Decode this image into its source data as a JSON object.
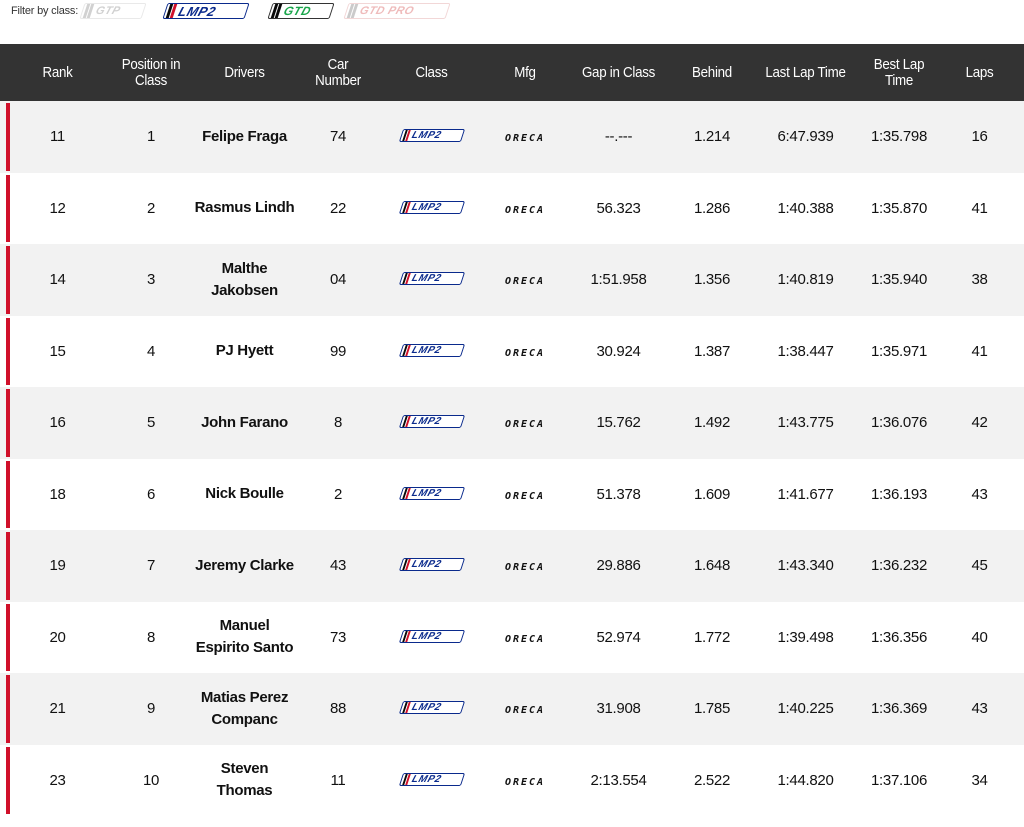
{
  "filter": {
    "label": "Filter by class:",
    "classes": [
      {
        "label": "GTP",
        "active": false
      },
      {
        "label": "LMP2",
        "active": true
      },
      {
        "label": "GTD",
        "active": true
      },
      {
        "label": "GTD PRO",
        "active": false
      }
    ]
  },
  "table": {
    "headers": [
      "Rank",
      "Position in Class",
      "Drivers",
      "Car Number",
      "Class",
      "Mfg",
      "Gap in Class",
      "Behind",
      "Last Lap Time",
      "Best Lap Time",
      "Laps"
    ],
    "rows": [
      {
        "rank": "11",
        "pos": "1",
        "driver1": "Felipe Fraga",
        "driver2": "",
        "car": "74",
        "class": "LMP2",
        "mfg": "ORECA",
        "gap": "--.---",
        "behind": "1.214",
        "last": "6:47.939",
        "best": "1:35.798",
        "laps": "16"
      },
      {
        "rank": "12",
        "pos": "2",
        "driver1": "Rasmus Lindh",
        "driver2": "",
        "car": "22",
        "class": "LMP2",
        "mfg": "ORECA",
        "gap": "56.323",
        "behind": "1.286",
        "last": "1:40.388",
        "best": "1:35.870",
        "laps": "41"
      },
      {
        "rank": "14",
        "pos": "3",
        "driver1": "Malthe",
        "driver2": "Jakobsen",
        "car": "04",
        "class": "LMP2",
        "mfg": "ORECA",
        "gap": "1:51.958",
        "behind": "1.356",
        "last": "1:40.819",
        "best": "1:35.940",
        "laps": "38"
      },
      {
        "rank": "15",
        "pos": "4",
        "driver1": "PJ Hyett",
        "driver2": "",
        "car": "99",
        "class": "LMP2",
        "mfg": "ORECA",
        "gap": "30.924",
        "behind": "1.387",
        "last": "1:38.447",
        "best": "1:35.971",
        "laps": "41"
      },
      {
        "rank": "16",
        "pos": "5",
        "driver1": "John Farano",
        "driver2": "",
        "car": "8",
        "class": "LMP2",
        "mfg": "ORECA",
        "gap": "15.762",
        "behind": "1.492",
        "last": "1:43.775",
        "best": "1:36.076",
        "laps": "42"
      },
      {
        "rank": "18",
        "pos": "6",
        "driver1": "Nick Boulle",
        "driver2": "",
        "car": "2",
        "class": "LMP2",
        "mfg": "ORECA",
        "gap": "51.378",
        "behind": "1.609",
        "last": "1:41.677",
        "best": "1:36.193",
        "laps": "43"
      },
      {
        "rank": "19",
        "pos": "7",
        "driver1": "Jeremy Clarke",
        "driver2": "",
        "car": "43",
        "class": "LMP2",
        "mfg": "ORECA",
        "gap": "29.886",
        "behind": "1.648",
        "last": "1:43.340",
        "best": "1:36.232",
        "laps": "45"
      },
      {
        "rank": "20",
        "pos": "8",
        "driver1": "Manuel",
        "driver2": "Espirito Santo",
        "car": "73",
        "class": "LMP2",
        "mfg": "ORECA",
        "gap": "52.974",
        "behind": "1.772",
        "last": "1:39.498",
        "best": "1:36.356",
        "laps": "40"
      },
      {
        "rank": "21",
        "pos": "9",
        "driver1": "Matias Perez",
        "driver2": "Companc",
        "car": "88",
        "class": "LMP2",
        "mfg": "ORECA",
        "gap": "31.908",
        "behind": "1.785",
        "last": "1:40.225",
        "best": "1:36.369",
        "laps": "43"
      },
      {
        "rank": "23",
        "pos": "10",
        "driver1": "Steven",
        "driver2": "Thomas",
        "car": "11",
        "class": "LMP2",
        "mfg": "ORECA",
        "gap": "2:13.554",
        "behind": "2.522",
        "last": "1:44.820",
        "best": "1:37.106",
        "laps": "34"
      }
    ]
  },
  "colors": {
    "header_bg": "#333333",
    "accent_red": "#d0102a",
    "lmp2_blue": "#0a2a8c",
    "gtd_green": "#19a54a",
    "row_alt": "#f2f2f2"
  }
}
